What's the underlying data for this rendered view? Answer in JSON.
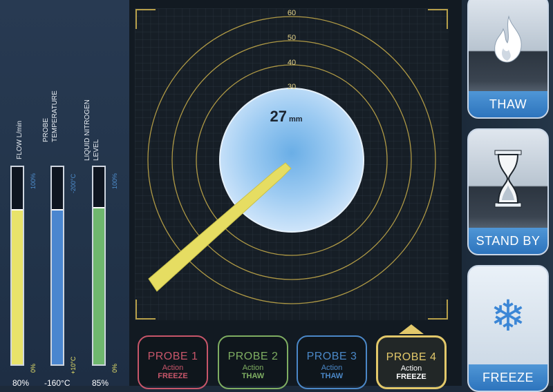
{
  "gauges": [
    {
      "label_lines": [
        "FLOW  L/min"
      ],
      "top": "100%",
      "bottom": "0%",
      "value": "80%",
      "fill_fraction": 0.78,
      "color": "#e8e36a",
      "scale_color": "#4f8fd0"
    },
    {
      "label_lines": [
        "PROBE",
        "TEMPERATURE"
      ],
      "top": "-200°C",
      "bottom": "+10°C",
      "value": "-160°C",
      "fill_fraction": 0.78,
      "color": "#4a86cf",
      "scale_color": "#4f8fd0"
    },
    {
      "label_lines": [
        "LIQUID NITROGEN",
        "LEVEL"
      ],
      "top": "100%",
      "bottom": "0%",
      "value": "85%",
      "fill_fraction": 0.79,
      "color": "#6fb76e",
      "scale_color": "#4f8fd0"
    }
  ],
  "target": {
    "distance_value": "27",
    "distance_unit": "mm",
    "ring_labels": [
      "60",
      "50",
      "40",
      "30"
    ]
  },
  "probes": [
    {
      "name": "PROBE 1",
      "action": "Action",
      "mode": "FREEZE",
      "color": "#c8566a"
    },
    {
      "name": "PROBE 2",
      "action": "Action",
      "mode": "THAW",
      "color": "#7fae62"
    },
    {
      "name": "PROBE 3",
      "action": "Action",
      "mode": "THAW",
      "color": "#4b88c8"
    },
    {
      "name": "PROBE 4",
      "action": "Action",
      "mode": "FREEZE",
      "color": "#e2c86a",
      "active": true
    }
  ],
  "controls": [
    {
      "label": "THAW",
      "icon": "flame-icon"
    },
    {
      "label": "STAND BY",
      "icon": "hourglass-icon"
    },
    {
      "label": "FREEZE",
      "icon": "snowflake-icon"
    }
  ]
}
